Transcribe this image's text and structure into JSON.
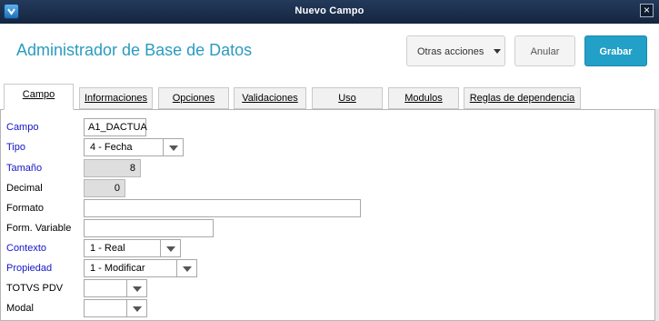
{
  "window": {
    "title": "Nuevo Campo",
    "close_glyph": "×"
  },
  "header": {
    "page_title": "Administrador de Base de Datos",
    "more_actions_label": "Otras acciones",
    "cancel_label": "Anular",
    "save_label": "Grabar",
    "accent_color": "#22a0c7"
  },
  "tabs": [
    {
      "label": "Campo",
      "active": true
    },
    {
      "label": "Informaciones",
      "active": false
    },
    {
      "label": "Opciones",
      "active": false
    },
    {
      "label": "Validaciones",
      "active": false
    },
    {
      "label": "Uso",
      "active": false
    },
    {
      "label": "Modulos",
      "active": false
    },
    {
      "label": "Reglas de dependencia",
      "active": false
    }
  ],
  "form": {
    "campo": {
      "label": "Campo",
      "value": "A1_DACTUA"
    },
    "tipo": {
      "label": "Tipo",
      "value": "4 - Fecha"
    },
    "tamano": {
      "label": "Tamaño",
      "value": "8"
    },
    "decimal": {
      "label": "Decimal",
      "value": "0"
    },
    "formato": {
      "label": "Formato",
      "value": ""
    },
    "form_variable": {
      "label": "Form. Variable",
      "value": ""
    },
    "contexto": {
      "label": "Contexto",
      "value": "1 - Real"
    },
    "propiedad": {
      "label": "Propiedad",
      "value": "1 - Modificar"
    },
    "totvs_pdv": {
      "label": "TOTVS PDV",
      "value": ""
    },
    "modal": {
      "label": "Modal",
      "value": ""
    }
  },
  "icons": {
    "app": "app-logo-icon",
    "close": "close-icon",
    "dropdown": "chevron-down-icon"
  }
}
